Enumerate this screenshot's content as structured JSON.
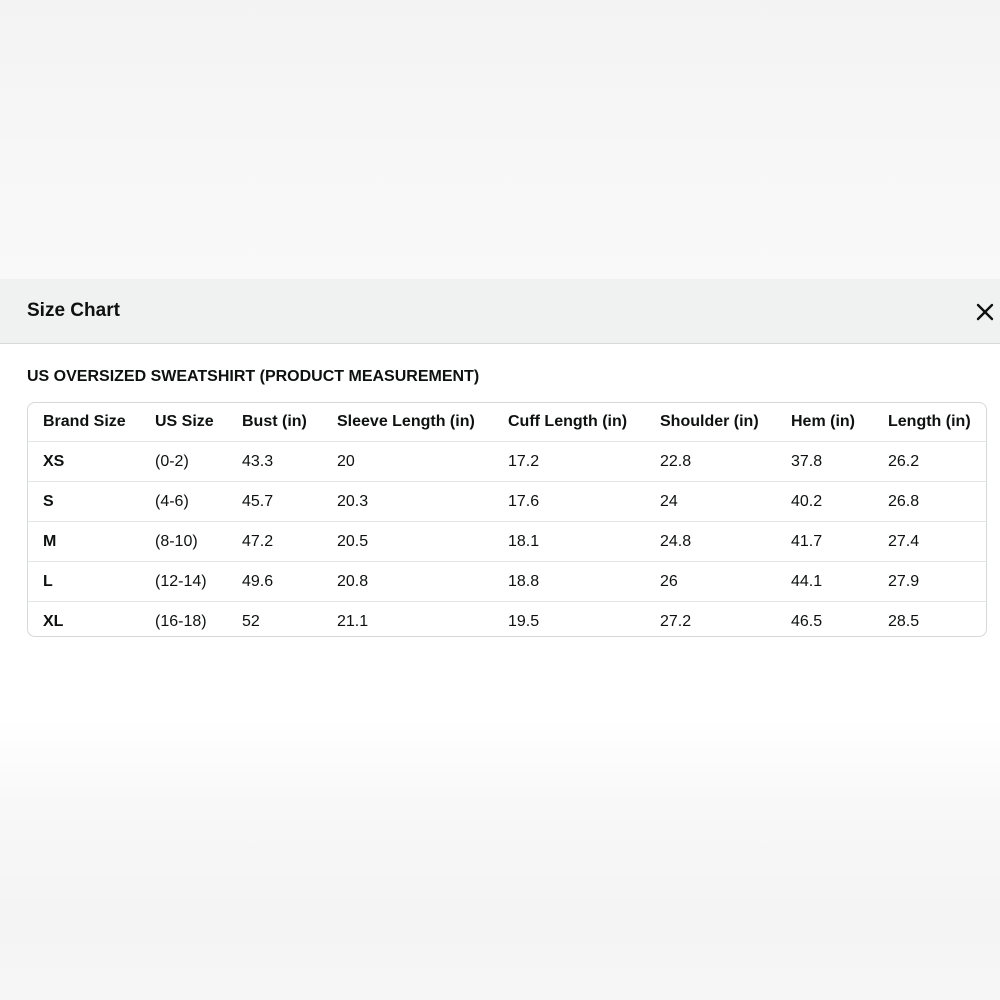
{
  "modal": {
    "title": "Size Chart",
    "close_icon": "close-icon"
  },
  "section": {
    "heading": "US OVERSIZED SWEATSHIRT (PRODUCT MEASUREMENT)"
  },
  "table": {
    "columns": [
      "Brand Size",
      "US Size",
      "Bust (in)",
      "Sleeve Length (in)",
      "Cuff Length (in)",
      "Shoulder (in)",
      "Hem (in)",
      "Length (in)"
    ],
    "rows": [
      [
        "XS",
        "(0-2)",
        "43.3",
        "20",
        "17.2",
        "22.8",
        "37.8",
        "26.2"
      ],
      [
        "S",
        "(4-6)",
        "45.7",
        "20.3",
        "17.6",
        "24",
        "40.2",
        "26.8"
      ],
      [
        "M",
        "(8-10)",
        "47.2",
        "20.5",
        "18.1",
        "24.8",
        "41.7",
        "27.4"
      ],
      [
        "L",
        "(12-14)",
        "49.6",
        "20.8",
        "18.8",
        "26",
        "44.1",
        "27.9"
      ],
      [
        "XL",
        "(16-18)",
        "52",
        "21.1",
        "19.5",
        "27.2",
        "46.5",
        "28.5"
      ]
    ]
  },
  "colors": {
    "header_bg": "#f0f2f2",
    "text": "#0f1111",
    "border": "#d5d9d9"
  }
}
